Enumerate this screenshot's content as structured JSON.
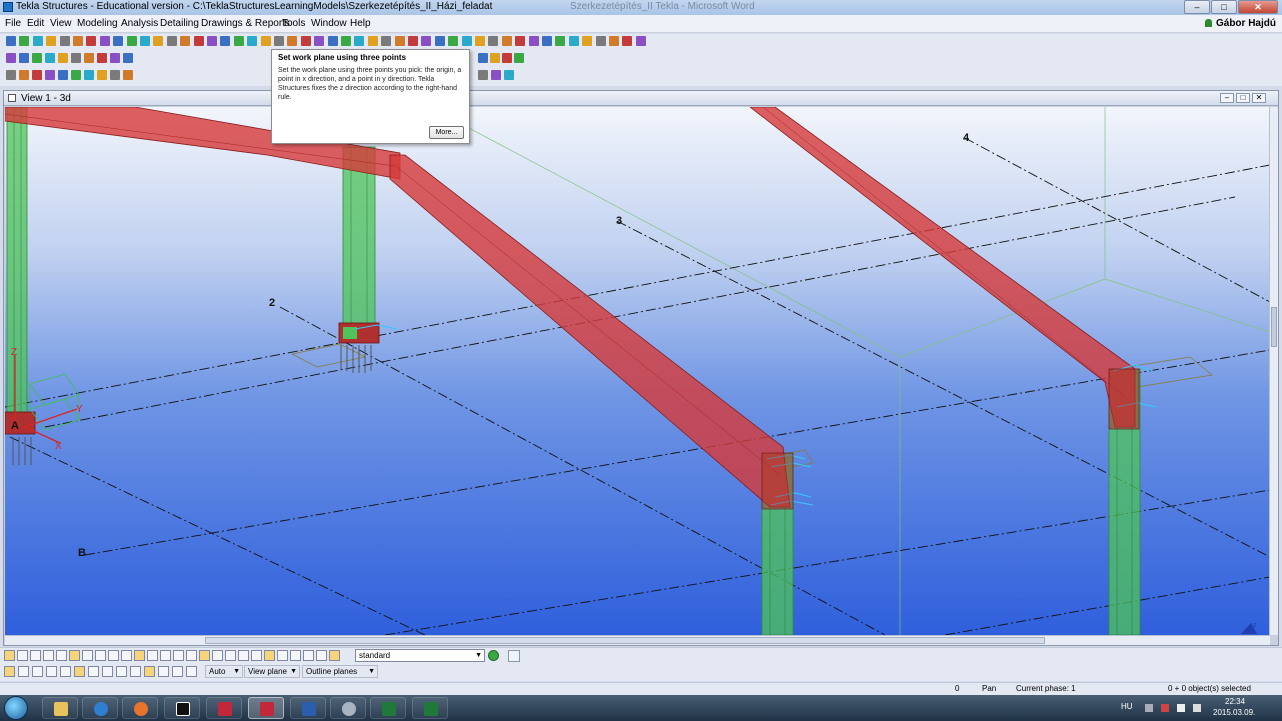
{
  "window": {
    "title": "Tekla Structures - Educational version - C:\\TeklaStructuresLearningModels\\Szerkezetépítés_II_Házi_feladat",
    "background_window_title": "Szerkezetépítés_II Tekla - Microsoft Word",
    "user_name": "Gábor Hajdú",
    "buttons": {
      "minimize": "–",
      "maximize": "□",
      "close": "✕"
    }
  },
  "menu": [
    "File",
    "Edit",
    "View",
    "Modeling",
    "Analysis",
    "Detailing",
    "Drawings & Reports",
    "Tools",
    "Window",
    "Help"
  ],
  "tooltip": {
    "title": "Set work plane using three points",
    "body": "Set the work plane using three points you pick: the origin, a point in x direction, and a point in y direction. Tekla Structures fixes the z direction according to the right-hand rule.",
    "more_button": "More..."
  },
  "view": {
    "title": "View 1 - 3d",
    "grid_labels": {
      "g2": "2",
      "g3": "3",
      "g4": "4",
      "gA": "A",
      "gB": "B"
    },
    "axis_labels": {
      "x": "X",
      "y": "Y",
      "z": "Z"
    },
    "colors": {
      "beam": "#d63a3a",
      "column": "#4fc45a",
      "gridline": "#111111",
      "sky_top": "#f2f5fb",
      "sky_bottom": "#2f5fdc"
    }
  },
  "bottom_toolbar": {
    "filter_value": "standard",
    "snap_mode": "Auto",
    "plane_mode": "View plane",
    "plane_display": "Outline planes"
  },
  "status": {
    "count": "0",
    "mode": "Pan",
    "phase": "Current phase: 1",
    "selection": "0 + 0 object(s) selected"
  },
  "taskbar": {
    "language": "HU",
    "time": "22:34",
    "date": "2015.03.09.",
    "apps": [
      "windows-explorer",
      "media-player",
      "firefox",
      "archicad",
      "tekla-19",
      "tekla",
      "word",
      "settings",
      "excel-1",
      "excel-2"
    ]
  }
}
